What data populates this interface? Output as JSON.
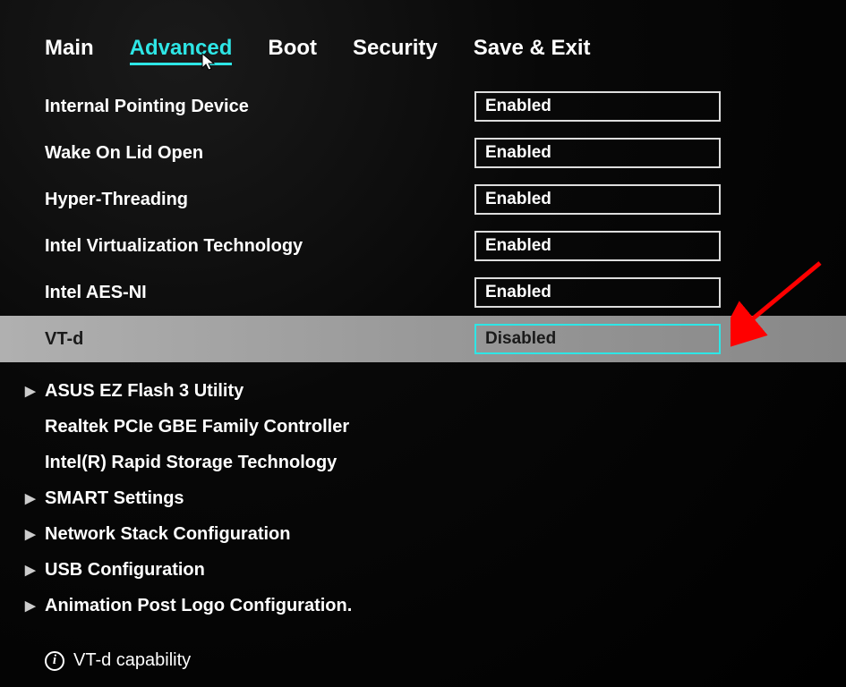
{
  "tabs": {
    "main": "Main",
    "advanced": "Advanced",
    "boot": "Boot",
    "security": "Security",
    "save_exit": "Save & Exit"
  },
  "settings": [
    {
      "label": "Internal Pointing Device",
      "value": "Enabled"
    },
    {
      "label": "Wake On Lid Open",
      "value": "Enabled"
    },
    {
      "label": "Hyper-Threading",
      "value": "Enabled"
    },
    {
      "label": "Intel Virtualization Technology",
      "value": "Enabled"
    },
    {
      "label": "Intel AES-NI",
      "value": "Enabled"
    },
    {
      "label": "VT-d",
      "value": "Disabled"
    }
  ],
  "submenus": [
    {
      "label": "ASUS EZ Flash 3 Utility",
      "chevron": true
    },
    {
      "label": "Realtek PCIe GBE Family Controller",
      "chevron": false
    },
    {
      "label": "Intel(R) Rapid Storage Technology",
      "chevron": false
    },
    {
      "label": "SMART Settings",
      "chevron": true
    },
    {
      "label": "Network Stack Configuration",
      "chevron": true
    },
    {
      "label": "USB Configuration",
      "chevron": true
    },
    {
      "label": "Animation Post Logo Configuration.",
      "chevron": true
    }
  ],
  "help_text": "VT-d capability",
  "colors": {
    "accent": "#2ee6e6",
    "selected_bg": "#a0a0a0",
    "arrow": "#ff0000"
  }
}
